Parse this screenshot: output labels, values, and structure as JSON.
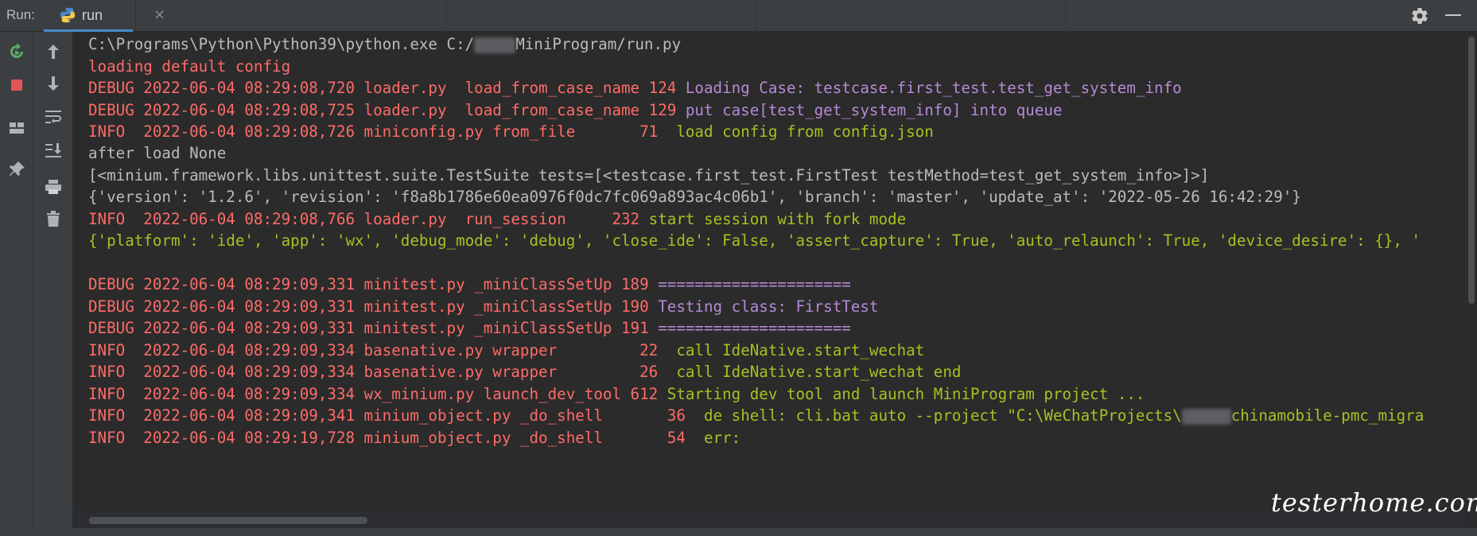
{
  "header": {
    "run_label": "Run:",
    "tab_label": "run",
    "close_glyph": "×",
    "settings_icon": "gear-icon",
    "minimize_icon": "minimize-icon"
  },
  "toolbar": {
    "left_column": [
      "rerun-icon",
      "stop-icon",
      "layout-icon",
      "pin-icon"
    ],
    "right_column": [
      "arrow-up-icon",
      "arrow-down-icon",
      "soft-wrap-icon",
      "scroll-to-end-icon",
      "print-icon",
      "trash-icon"
    ]
  },
  "console": {
    "line1_a": "C:\\Programs\\Python\\Python39\\python.exe C:/",
    "line1_b": "MiniProgram/run.py",
    "line2": "loading default config",
    "line3_a": "DEBUG 2022-06-04 08:29:08,720 loader.py  load_from_case_name 124 ",
    "line3_b": "Loading Case: testcase.first_test.test_get_system_info",
    "line4_a": "DEBUG 2022-06-04 08:29:08,725 loader.py  load_from_case_name 129 ",
    "line4_b": "put case[test_get_system_info] into queue",
    "line5_a": "INFO  2022-06-04 08:29:08,726 miniconfig.py from_file       71  ",
    "line5_b": "load config from config.json",
    "line6": "after load None",
    "line7": "[<minium.framework.libs.unittest.suite.TestSuite tests=[<testcase.first_test.FirstTest testMethod=test_get_system_info>]>]",
    "line8": "{'version': '1.2.6', 'revision': 'f8a8b1786e60ea0976f0dc7fc069a893ac4c06b1', 'branch': 'master', 'update_at': '2022-05-26 16:42:29'}",
    "line9_a": "INFO  2022-06-04 08:29:08,766 loader.py  run_session     232 ",
    "line9_b": "start session with fork mode",
    "line10": "{'platform': 'ide', 'app': 'wx', 'debug_mode': 'debug', 'close_ide': False, 'assert_capture': True, 'auto_relaunch': True, 'device_desire': {}, '",
    "line11_a": "DEBUG 2022-06-04 08:29:09,331 minitest.py _miniClassSetUp 189 ",
    "line11_b": "=====================",
    "line12_a": "DEBUG 2022-06-04 08:29:09,331 minitest.py _miniClassSetUp 190 ",
    "line12_b": "Testing class: FirstTest",
    "line13_a": "DEBUG 2022-06-04 08:29:09,331 minitest.py _miniClassSetUp 191 ",
    "line13_b": "=====================",
    "line14_a": "INFO  2022-06-04 08:29:09,334 basenative.py wrapper         22  ",
    "line14_b": "call IdeNative.start_wechat",
    "line15_a": "INFO  2022-06-04 08:29:09,334 basenative.py wrapper         26  ",
    "line15_b": "call IdeNative.start_wechat end",
    "line16_a": "INFO  2022-06-04 08:29:09,334 wx_minium.py launch_dev_tool 612 ",
    "line16_b": "Starting dev tool and launch MiniProgram project ...",
    "line17_a": "INFO  2022-06-04 08:29:09,341 minium_object.py _do_shell       36  ",
    "line17_b": "de shell: cli.bat auto --project \"C:\\WeChatProjects\\",
    "line17_c": "chinamobile-pmc_migra",
    "line18_a": "INFO  2022-06-04 08:29:19,728 minium_object.py _do_shell       54  ",
    "line18_b": "err:"
  },
  "watermark": "testerhome.com"
}
